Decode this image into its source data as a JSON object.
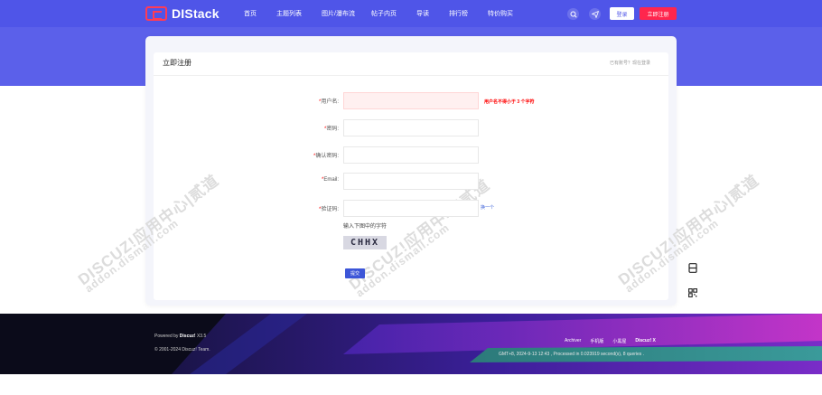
{
  "brand": {
    "logo_text": "DIStack",
    "accent": "#4f55e8",
    "danger": "#ff264d"
  },
  "nav": {
    "items": [
      {
        "label": "首页"
      },
      {
        "label": "主题列表"
      },
      {
        "label": "图片/瀑布流"
      },
      {
        "label": "帖子内页"
      },
      {
        "label": "导读"
      },
      {
        "label": "排行榜"
      },
      {
        "label": "特价购买"
      }
    ],
    "search_icon": "search-icon",
    "send_icon": "send-icon",
    "login_label": "登录",
    "register_label": "立即注册"
  },
  "register_card": {
    "title": "立即注册",
    "login_link": "已有账号？现在登录",
    "fields": [
      {
        "required": "*",
        "label": "用户名:",
        "value": "",
        "error": "用户名不得小于 3 个字符"
      },
      {
        "required": "*",
        "label": "密码:",
        "value": ""
      },
      {
        "required": "*",
        "label": "确认密码:",
        "value": ""
      },
      {
        "required": "*",
        "label": "Email:",
        "value": ""
      },
      {
        "required": "*",
        "label": "验证码:",
        "value": ""
      }
    ],
    "captcha_refresh": "换一个",
    "captcha_hint": "输入下图中的字符",
    "captcha_text": "CHHX",
    "submit_label": "提交"
  },
  "watermark": {
    "main": "DISCUZ!应用中心|贰道",
    "sub": "addon.dismall.com"
  },
  "side_tools": [
    "page-icon",
    "qrcode-icon"
  ],
  "footer": {
    "powered_prefix": "Powered by",
    "powered_brand": "Discuz!",
    "powered_version": "X3.5",
    "copyright": "© 2001-2024 Discuz! Team.",
    "links": [
      {
        "label": "Archiver"
      },
      {
        "label": "手机版"
      },
      {
        "label": "小黑屋"
      },
      {
        "label": "Discuz! X"
      }
    ],
    "stats": "GMT+8, 2024-9-13 12:43 , Processed in 0.023919 second(s), 8 queries ."
  }
}
